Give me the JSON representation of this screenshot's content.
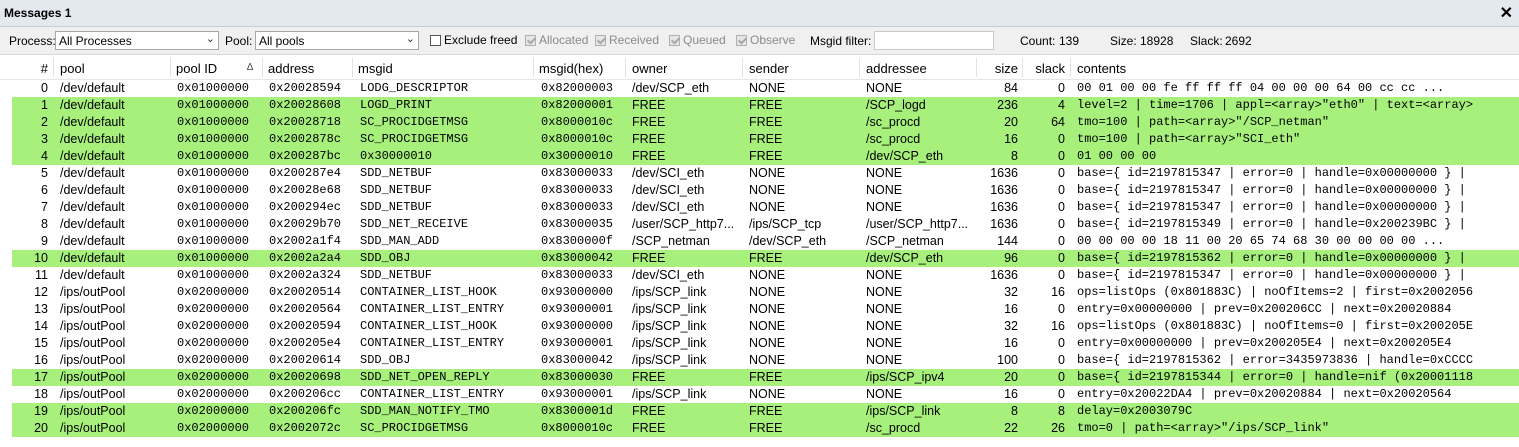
{
  "window": {
    "title": "Messages 1",
    "close_glyph": "✕"
  },
  "toolbar": {
    "process_label": "Process:",
    "process_value": "All Processes",
    "pool_label": "Pool:",
    "pool_value": "All pools",
    "exclude_freed": {
      "label": "Exclude freed",
      "checked": false,
      "enabled": true
    },
    "allocated": {
      "label": "Allocated",
      "checked": true,
      "enabled": false
    },
    "received": {
      "label": "Received",
      "checked": true,
      "enabled": false
    },
    "queued": {
      "label": "Queued",
      "checked": true,
      "enabled": false
    },
    "observe": {
      "label": "Observe",
      "checked": true,
      "enabled": false
    },
    "msgid_filter_label": "Msgid filter:",
    "msgid_filter_value": "",
    "count_label": "Count:",
    "count_value": "139",
    "size_label": "Size:",
    "size_value": "18928",
    "slack_label": "Slack:",
    "slack_value": "2692"
  },
  "table": {
    "columns": [
      "#",
      "pool",
      "pool ID",
      "address",
      "msgid",
      "msgid(hex)",
      "owner",
      "sender",
      "addressee",
      "size",
      "slack",
      "contents"
    ],
    "sort_indicator": "∆",
    "highlight_color": "#a7f07c",
    "rows": [
      {
        "n": "0",
        "pool": "/dev/default",
        "pool_id": "0x01000000",
        "address": "0x20028594",
        "msgid": "LODG_DESCRIPTOR",
        "msgid_hex": "0x82000003",
        "owner": "/dev/SCP_eth",
        "sender": "NONE",
        "addressee": "NONE",
        "size": "84",
        "slack": "0",
        "contents": "00 01 00 00 fe ff ff ff 04 00 00 00 64 00 cc cc ...",
        "hl": false
      },
      {
        "n": "1",
        "pool": "/dev/default",
        "pool_id": "0x01000000",
        "address": "0x20028608",
        "msgid": "LOGD_PRINT",
        "msgid_hex": "0x82000001",
        "owner": "FREE",
        "sender": "FREE",
        "addressee": "/SCP_logd",
        "size": "236",
        "slack": "4",
        "contents": "level=2 | time=1706 | appl=<array>\"eth0\" | text=<array>",
        "hl": true
      },
      {
        "n": "2",
        "pool": "/dev/default",
        "pool_id": "0x01000000",
        "address": "0x20028718",
        "msgid": "SC_PROCIDGETMSG",
        "msgid_hex": "0x8000010c",
        "owner": "FREE",
        "sender": "FREE",
        "addressee": "/sc_procd",
        "size": "20",
        "slack": "64",
        "contents": "tmo=100 | path=<array>\"/SCP_netman\"",
        "hl": true
      },
      {
        "n": "3",
        "pool": "/dev/default",
        "pool_id": "0x01000000",
        "address": "0x2002878c",
        "msgid": "SC_PROCIDGETMSG",
        "msgid_hex": "0x8000010c",
        "owner": "FREE",
        "sender": "FREE",
        "addressee": "/sc_procd",
        "size": "16",
        "slack": "0",
        "contents": "tmo=100 | path=<array>\"SCI_eth\"",
        "hl": true
      },
      {
        "n": "4",
        "pool": "/dev/default",
        "pool_id": "0x01000000",
        "address": "0x200287bc",
        "msgid": "0x30000010",
        "msgid_hex": "0x30000010",
        "owner": "FREE",
        "sender": "FREE",
        "addressee": "/dev/SCP_eth",
        "size": "8",
        "slack": "0",
        "contents": "01 00 00 00",
        "hl": true
      },
      {
        "n": "5",
        "pool": "/dev/default",
        "pool_id": "0x01000000",
        "address": "0x200287e4",
        "msgid": "SDD_NETBUF",
        "msgid_hex": "0x83000033",
        "owner": "/dev/SCI_eth",
        "sender": "NONE",
        "addressee": "NONE",
        "size": "1636",
        "slack": "0",
        "contents": "base={ id=2197815347 | error=0 | handle=0x00000000 } |",
        "hl": false
      },
      {
        "n": "6",
        "pool": "/dev/default",
        "pool_id": "0x01000000",
        "address": "0x20028e68",
        "msgid": "SDD_NETBUF",
        "msgid_hex": "0x83000033",
        "owner": "/dev/SCI_eth",
        "sender": "NONE",
        "addressee": "NONE",
        "size": "1636",
        "slack": "0",
        "contents": "base={ id=2197815347 | error=0 | handle=0x00000000 } |",
        "hl": false
      },
      {
        "n": "7",
        "pool": "/dev/default",
        "pool_id": "0x01000000",
        "address": "0x200294ec",
        "msgid": "SDD_NETBUF",
        "msgid_hex": "0x83000033",
        "owner": "/dev/SCI_eth",
        "sender": "NONE",
        "addressee": "NONE",
        "size": "1636",
        "slack": "0",
        "contents": "base={ id=2197815347 | error=0 | handle=0x00000000 } |",
        "hl": false
      },
      {
        "n": "8",
        "pool": "/dev/default",
        "pool_id": "0x01000000",
        "address": "0x20029b70",
        "msgid": "SDD_NET_RECEIVE",
        "msgid_hex": "0x83000035",
        "owner": "/user/SCP_http7...",
        "sender": "/ips/SCP_tcp",
        "addressee": "/user/SCP_http7...",
        "size": "1636",
        "slack": "0",
        "contents": "base={ id=2197815349 | error=0 | handle=0x200239BC } |",
        "hl": false
      },
      {
        "n": "9",
        "pool": "/dev/default",
        "pool_id": "0x01000000",
        "address": "0x2002a1f4",
        "msgid": "SDD_MAN_ADD",
        "msgid_hex": "0x8300000f",
        "owner": "/SCP_netman",
        "sender": "/dev/SCP_eth",
        "addressee": "/SCP_netman",
        "size": "144",
        "slack": "0",
        "contents": "00 00 00 00 18 11 00 20 65 74 68 30 00 00 00 00 ...",
        "hl": false
      },
      {
        "n": "10",
        "pool": "/dev/default",
        "pool_id": "0x01000000",
        "address": "0x2002a2a4",
        "msgid": "SDD_OBJ",
        "msgid_hex": "0x83000042",
        "owner": "FREE",
        "sender": "FREE",
        "addressee": "/dev/SCP_eth",
        "size": "96",
        "slack": "0",
        "contents": "base={ id=2197815362 | error=0 | handle=0x00000000 } |",
        "hl": true
      },
      {
        "n": "11",
        "pool": "/dev/default",
        "pool_id": "0x01000000",
        "address": "0x2002a324",
        "msgid": "SDD_NETBUF",
        "msgid_hex": "0x83000033",
        "owner": "/dev/SCI_eth",
        "sender": "NONE",
        "addressee": "NONE",
        "size": "1636",
        "slack": "0",
        "contents": "base={ id=2197815347 | error=0 | handle=0x00000000 } |",
        "hl": false
      },
      {
        "n": "12",
        "pool": "/ips/outPool",
        "pool_id": "0x02000000",
        "address": "0x20020514",
        "msgid": "CONTAINER_LIST_HOOK",
        "msgid_hex": "0x93000000",
        "owner": "/ips/SCP_link",
        "sender": "NONE",
        "addressee": "NONE",
        "size": "32",
        "slack": "16",
        "contents": "ops=listOps (0x801883C) | noOfItems=2 | first=0x2002056",
        "hl": false
      },
      {
        "n": "13",
        "pool": "/ips/outPool",
        "pool_id": "0x02000000",
        "address": "0x20020564",
        "msgid": "CONTAINER_LIST_ENTRY",
        "msgid_hex": "0x93000001",
        "owner": "/ips/SCP_link",
        "sender": "NONE",
        "addressee": "NONE",
        "size": "16",
        "slack": "0",
        "contents": "entry=0x00000000 | prev=0x200206CC | next=0x20020884",
        "hl": false
      },
      {
        "n": "14",
        "pool": "/ips/outPool",
        "pool_id": "0x02000000",
        "address": "0x20020594",
        "msgid": "CONTAINER_LIST_HOOK",
        "msgid_hex": "0x93000000",
        "owner": "/ips/SCP_link",
        "sender": "NONE",
        "addressee": "NONE",
        "size": "32",
        "slack": "16",
        "contents": "ops=listOps (0x801883C) | noOfItems=0 | first=0x200205E",
        "hl": false
      },
      {
        "n": "15",
        "pool": "/ips/outPool",
        "pool_id": "0x02000000",
        "address": "0x200205e4",
        "msgid": "CONTAINER_LIST_ENTRY",
        "msgid_hex": "0x93000001",
        "owner": "/ips/SCP_link",
        "sender": "NONE",
        "addressee": "NONE",
        "size": "16",
        "slack": "0",
        "contents": "entry=0x00000000 | prev=0x200205E4 | next=0x200205E4",
        "hl": false
      },
      {
        "n": "16",
        "pool": "/ips/outPool",
        "pool_id": "0x02000000",
        "address": "0x20020614",
        "msgid": "SDD_OBJ",
        "msgid_hex": "0x83000042",
        "owner": "/ips/SCP_link",
        "sender": "NONE",
        "addressee": "NONE",
        "size": "100",
        "slack": "0",
        "contents": "base={ id=2197815362 | error=3435973836 | handle=0xCCCC",
        "hl": false
      },
      {
        "n": "17",
        "pool": "/ips/outPool",
        "pool_id": "0x02000000",
        "address": "0x20020698",
        "msgid": "SDD_NET_OPEN_REPLY",
        "msgid_hex": "0x83000030",
        "owner": "FREE",
        "sender": "FREE",
        "addressee": "/ips/SCP_ipv4",
        "size": "20",
        "slack": "0",
        "contents": "base={ id=2197815344 | error=0 | handle=nif (0x20001118",
        "hl": true
      },
      {
        "n": "18",
        "pool": "/ips/outPool",
        "pool_id": "0x02000000",
        "address": "0x200206cc",
        "msgid": "CONTAINER_LIST_ENTRY",
        "msgid_hex": "0x93000001",
        "owner": "/ips/SCP_link",
        "sender": "NONE",
        "addressee": "NONE",
        "size": "16",
        "slack": "0",
        "contents": "entry=0x20022DA4 | prev=0x20020884 | next=0x20020564",
        "hl": false
      },
      {
        "n": "19",
        "pool": "/ips/outPool",
        "pool_id": "0x02000000",
        "address": "0x200206fc",
        "msgid": "SDD_MAN_NOTIFY_TMO",
        "msgid_hex": "0x8300001d",
        "owner": "FREE",
        "sender": "FREE",
        "addressee": "/ips/SCP_link",
        "size": "8",
        "slack": "8",
        "contents": "delay=0x2003079C",
        "hl": true
      },
      {
        "n": "20",
        "pool": "/ips/outPool",
        "pool_id": "0x02000000",
        "address": "0x2002072c",
        "msgid": "SC_PROCIDGETMSG",
        "msgid_hex": "0x8000010c",
        "owner": "FREE",
        "sender": "FREE",
        "addressee": "/sc_procd",
        "size": "22",
        "slack": "26",
        "contents": "tmo=0 | path=<array>\"/ips/SCP_link\"",
        "hl": true
      }
    ]
  }
}
